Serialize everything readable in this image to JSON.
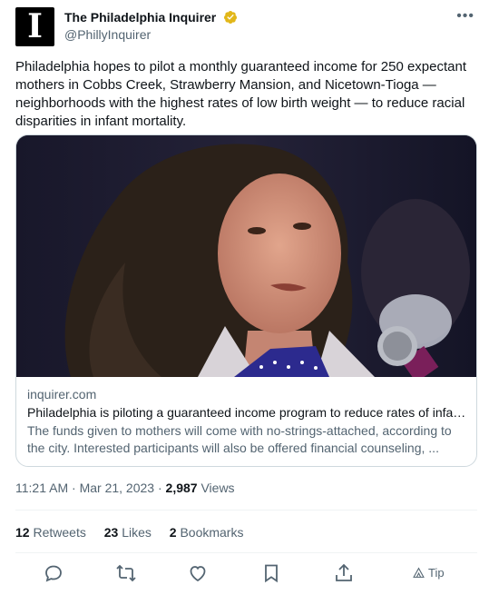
{
  "account": {
    "display_name": "The Philadelphia Inquirer",
    "handle": "@PhillyInquirer",
    "avatar_letter": "I",
    "verified_color": "#e2b719"
  },
  "tweet": {
    "text": "Philadelphia hopes to pilot a monthly guaranteed income for 250 expectant mothers in Cobbs Creek, Strawberry Mansion, and Nicetown-Tioga — neighborhoods with the highest rates of low birth weight — to reduce racial disparities in infant mortality."
  },
  "card": {
    "domain": "inquirer.com",
    "title": "Philadelphia is piloting a guaranteed income program to reduce rates of infan...",
    "description": "The funds given to mothers will come with no-strings-attached, according to the city. Interested participants will also be offered financial counseling, ..."
  },
  "meta": {
    "time": "11:21 AM",
    "separator": " · ",
    "date": "Mar 21, 2023",
    "views_count": "2,987",
    "views_label": "Views"
  },
  "stats": {
    "retweets_count": "12",
    "retweets_label": "Retweets",
    "likes_count": "23",
    "likes_label": "Likes",
    "bookmarks_count": "2",
    "bookmarks_label": "Bookmarks"
  },
  "actions": {
    "tip_label": "Tip"
  },
  "colors": {
    "secondary_text": "#536471",
    "primary_text": "#0f1419",
    "border": "#cfd9de"
  }
}
